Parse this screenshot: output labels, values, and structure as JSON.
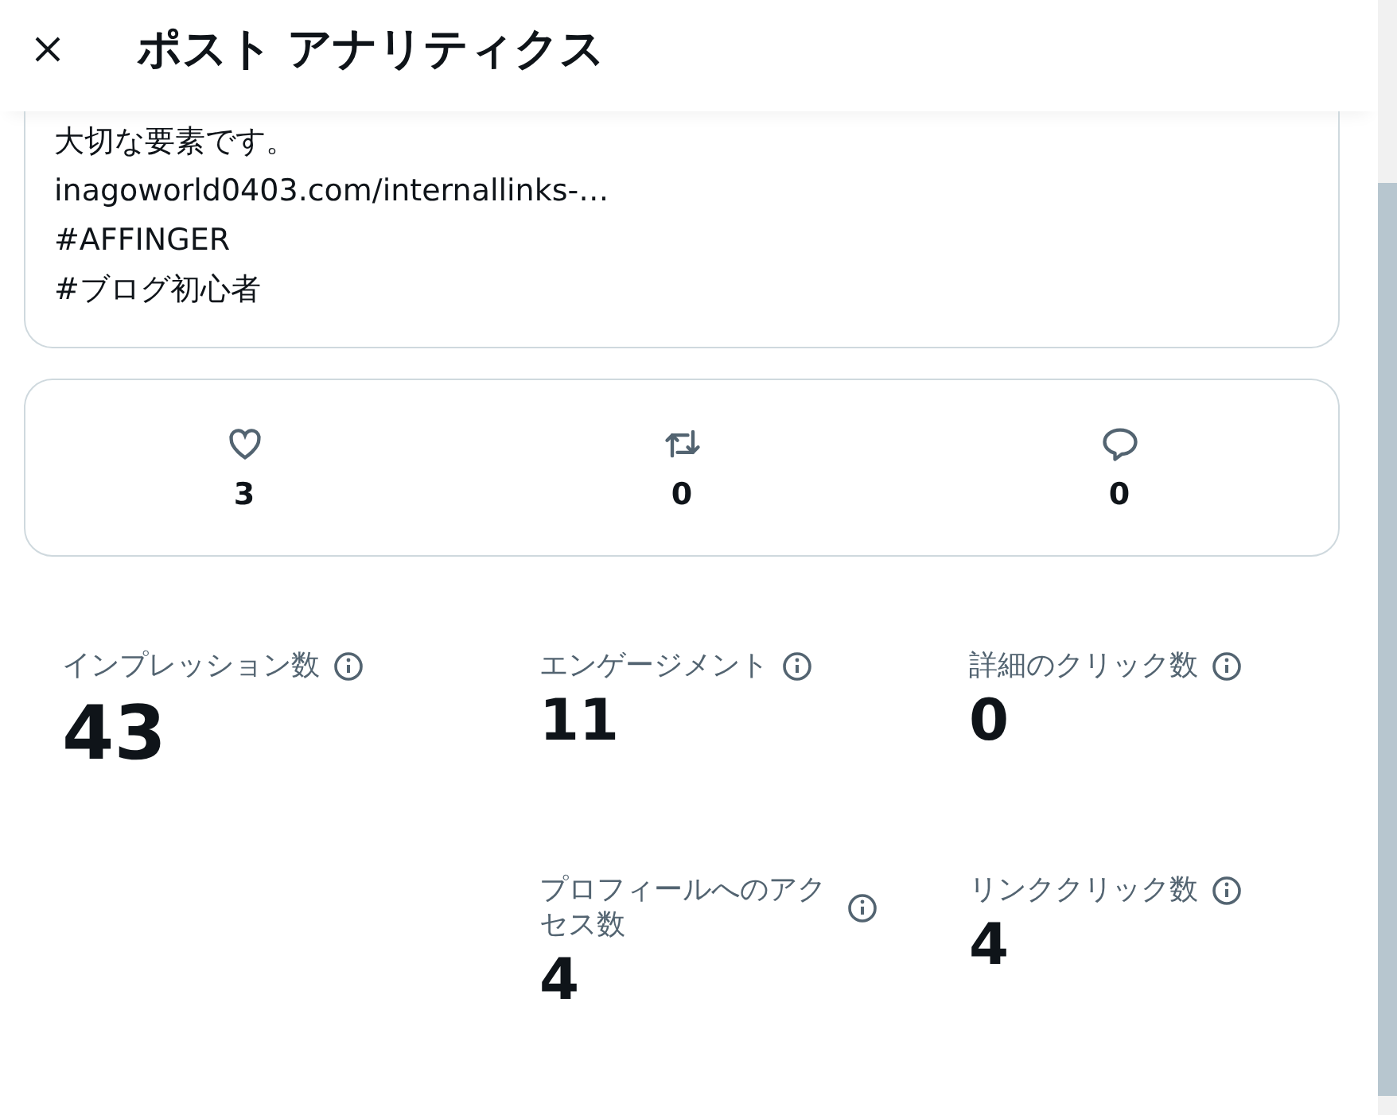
{
  "header": {
    "title": "ポスト アナリティクス"
  },
  "post": {
    "lines": [
      "大切な要素です。",
      "inagoworld0403.com/internallinks-…",
      "#AFFINGER",
      "#ブログ初心者"
    ]
  },
  "engagements": [
    {
      "kind": "like",
      "count": "3"
    },
    {
      "kind": "repost",
      "count": "0"
    },
    {
      "kind": "reply",
      "count": "0"
    }
  ],
  "metrics": [
    {
      "kind": "primary",
      "label": "インプレッション数",
      "value": "43"
    },
    {
      "kind": "secondary",
      "label": "エンゲージメント",
      "value": "11"
    },
    {
      "kind": "secondary",
      "label": "詳細のクリック数",
      "value": "0"
    },
    {
      "kind": "secondary",
      "label": "プロフィールへのアクセス数",
      "value": "4"
    },
    {
      "kind": "secondary",
      "label": "リンククリック数",
      "value": "4"
    }
  ]
}
